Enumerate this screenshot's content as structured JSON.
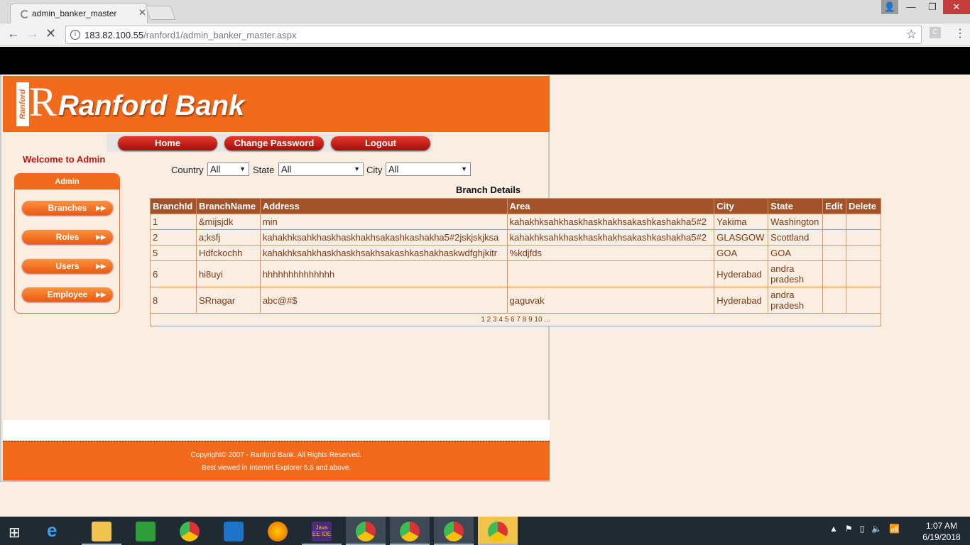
{
  "browser": {
    "tab_title": "admin_banker_master",
    "url_host": "183.82.100.55",
    "url_path": "/ranford1/admin_banker_master.aspx",
    "ext_label": "C"
  },
  "site": {
    "bank_name": "Ranford Bank",
    "logo_text": "Ranford",
    "logo_letter": "R",
    "menu": [
      "Home",
      "Change Password",
      "Logout"
    ],
    "welcome": "Welcome to Admin",
    "admin_title": "Admin",
    "sidebar": [
      "Branches",
      "Roles",
      "Users",
      "Employee"
    ],
    "filters": {
      "country_label": "Country",
      "country_value": "All",
      "state_label": "State",
      "state_value": "All",
      "city_label": "City",
      "city_value": "All"
    },
    "table_title": "Branch Details",
    "columns": [
      "BranchId",
      "BranchName",
      "Address",
      "Area",
      "City",
      "State",
      "Edit",
      "Delete"
    ],
    "rows": [
      [
        "1",
        "&mijsjdk",
        "min",
        "kahakhksahkhaskhaskhakhsakashkashakha5#2",
        "Yakima",
        "Washington",
        "",
        ""
      ],
      [
        "2",
        "a;ksfj",
        "kahakhksahkhaskhaskhakhsakashkashakha5#2jskjskjksa",
        "kahakhksahkhaskhaskhakhsakashkashakha5#2",
        "GLASGOW",
        "Scottland",
        "",
        ""
      ],
      [
        "5",
        "Hdfckochh",
        "kahakhksahkhaskhaskhsakhsakashkashakhaskwdfghjkitr",
        "%kdjfds",
        "GOA",
        "GOA",
        "",
        ""
      ],
      [
        "6",
        "hi8uyi",
        "hhhhhhhhhhhhhh",
        "",
        "Hyderabad",
        "andra pradesh",
        "",
        ""
      ],
      [
        "8",
        "SRnagar",
        "abc@#$",
        "gaguvak",
        "Hyderabad",
        "andra pradesh",
        "",
        ""
      ]
    ],
    "pager": "1 2 3 4 5 6 7 8 9 10 ...",
    "footer_line1": "Copyright© 2007 - Ranford Bank. All Rights Reserved.",
    "footer_line2": "Best viewed in Internet Explorer 5.5 and above."
  },
  "taskbar": {
    "time": "1:07 AM",
    "date": "6/19/2018",
    "java_label": "Java EE IDE"
  }
}
